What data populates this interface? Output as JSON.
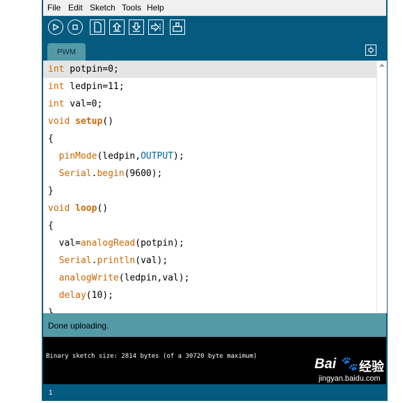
{
  "menu": [
    "File",
    "Edit",
    "Sketch",
    "Tools",
    "Help"
  ],
  "toolbar": {
    "buttons": [
      "verify-icon",
      "stop-icon",
      "new-icon",
      "open-icon",
      "save-icon",
      "upload-icon",
      "serial-monitor-icon"
    ]
  },
  "tab": {
    "label": "PWM"
  },
  "code": {
    "lines": [
      "int potpin=0;",
      "int ledpin=11;",
      "int val=0;",
      "void setup()",
      "{",
      "  pinMode(ledpin,OUTPUT);",
      "  Serial.begin(9600);",
      "}",
      "void loop()",
      "{",
      "  val=analogRead(potpin);",
      "  Serial.println(val);",
      "  analogWrite(ledpin,val);",
      "  delay(10);",
      "}"
    ]
  },
  "status": {
    "message": "Done uploading."
  },
  "console": {
    "output": "Binary sketch size: 2814 bytes (of a 30720 byte maximum)"
  },
  "footer": {
    "line_number": "1"
  },
  "watermark": {
    "brand": "Bai",
    "paw": "🐾",
    "brand_cn": "经验",
    "url": "jingyan.baidu.com"
  },
  "colors": {
    "toolbar": "#045a7f",
    "status": "#539aa6",
    "console": "#000000",
    "keyword": "#cc6600",
    "constant": "#006699"
  }
}
